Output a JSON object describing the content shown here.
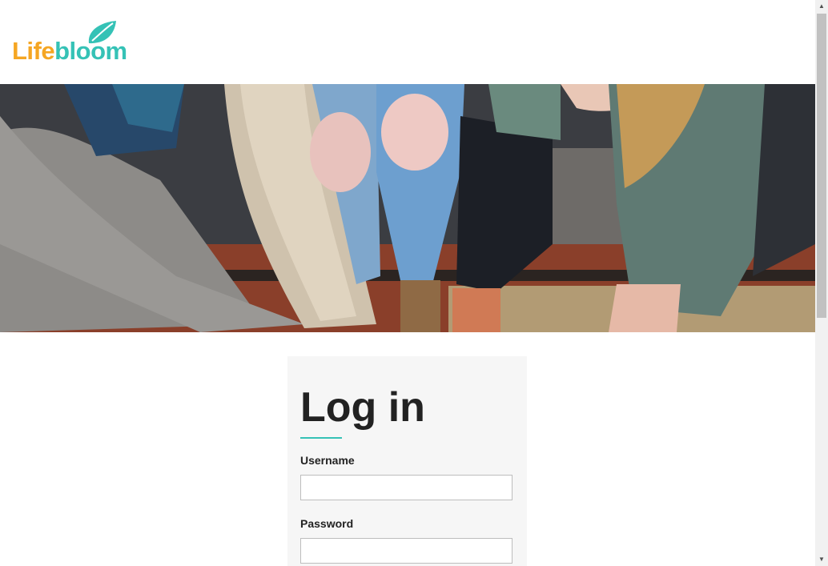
{
  "header": {
    "logo": {
      "part1": "Life",
      "part2": "bloom",
      "icon": "leaf-icon"
    }
  },
  "hero": {
    "description_icon": "hero-photo"
  },
  "login": {
    "title": "Log in",
    "username_label": "Username",
    "username_value": "",
    "password_label": "Password",
    "password_value": ""
  },
  "scrollbar": {
    "up_icon": "scroll-up-arrow",
    "down_icon": "scroll-down-arrow"
  },
  "colors": {
    "brand_orange": "#f5a623",
    "brand_teal": "#35c2b6",
    "card_bg": "#f6f6f6"
  }
}
